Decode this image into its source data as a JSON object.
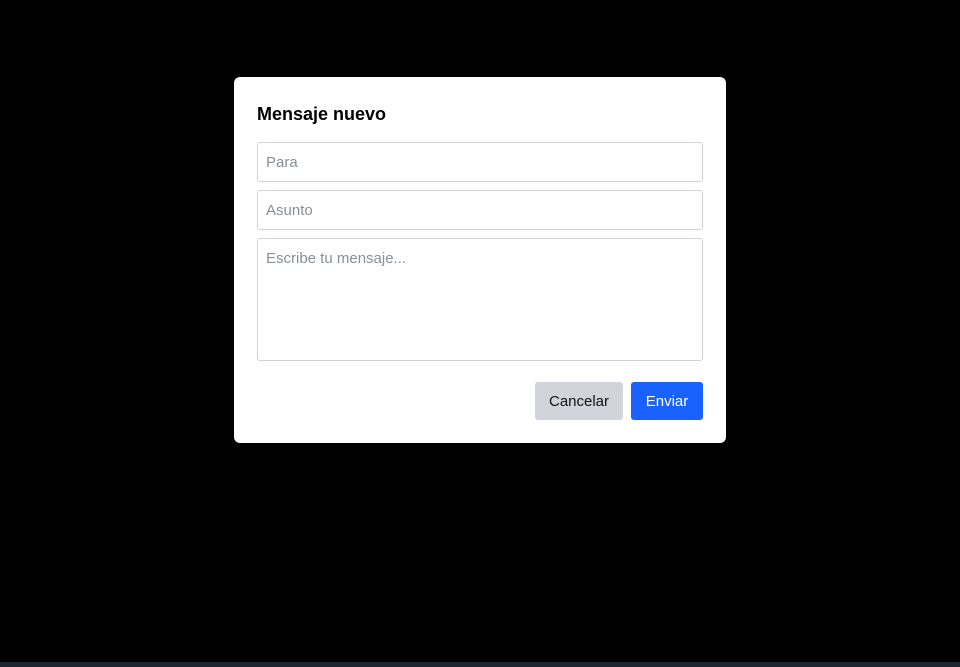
{
  "dialog": {
    "title": "Mensaje nuevo",
    "to_placeholder": "Para",
    "to_value": "",
    "subject_placeholder": "Asunto",
    "subject_value": "",
    "body_placeholder": "Escribe tu mensaje...",
    "body_value": "",
    "cancel_label": "Cancelar",
    "send_label": "Enviar"
  },
  "colors": {
    "backdrop": "#000000",
    "dialog_background": "#ffffff",
    "cancel_button": "#d1d5db",
    "send_button": "#1a62ff"
  }
}
